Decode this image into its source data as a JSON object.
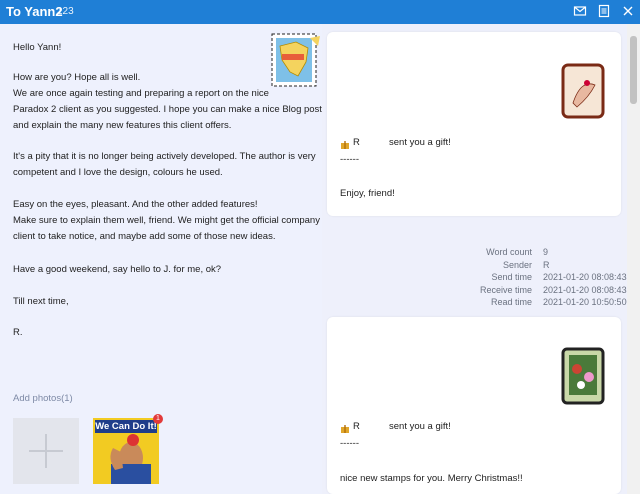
{
  "window": {
    "title": "To Yann2",
    "count": "123"
  },
  "letter": {
    "greeting": "Hello Yann!",
    "p1": "How are you? Hope all is well.\nWe are once again testing and preparing a report on the nice\nParadox 2 client as you suggested. I hope you can make a nice Blog post\nand explain the many new features this client offers.",
    "p2": "It's a pity that it is no longer being actively developed. The author is very\ncompetent and I love the design, colours he used.",
    "p3": "Easy on the eyes, pleasant. And the other added features!\nMake sure to explain them well, friend. We might get the official company\nclient to take notice, and maybe add some of those new ideas.",
    "p4": "Have a good weekend, say hello to J. for me, ok?",
    "p5": "Till next time,",
    "signature": "R.",
    "add_photos": "Add photos(1)",
    "poster_text": "We Can Do It!",
    "badge_count": "1"
  },
  "gifts": [
    {
      "sender": "R",
      "text": "sent you a gift!",
      "dash": "------",
      "message": "Enjoy, friend!"
    },
    {
      "sender": "R",
      "text": "sent you a gift!",
      "dash": "------",
      "message": "nice new stamps for you. Merry Christmas!!"
    }
  ],
  "meta": [
    {
      "key": "Word count",
      "value": "9"
    },
    {
      "key": "Sender",
      "value": "R"
    },
    {
      "key": "Send time",
      "value": "2021-01-20 08:08:43"
    },
    {
      "key": "Receive time",
      "value": "2021-01-20 08:08:43"
    },
    {
      "key": "Read time",
      "value": "2021-01-20 10:50:50"
    }
  ],
  "icons": {
    "mail": "mail-icon",
    "notes": "notes-icon",
    "gift": "gift-icon"
  },
  "colors": {
    "titlebar": "#1f7fd6",
    "background": "#eef0fb",
    "card": "#ffffff"
  }
}
